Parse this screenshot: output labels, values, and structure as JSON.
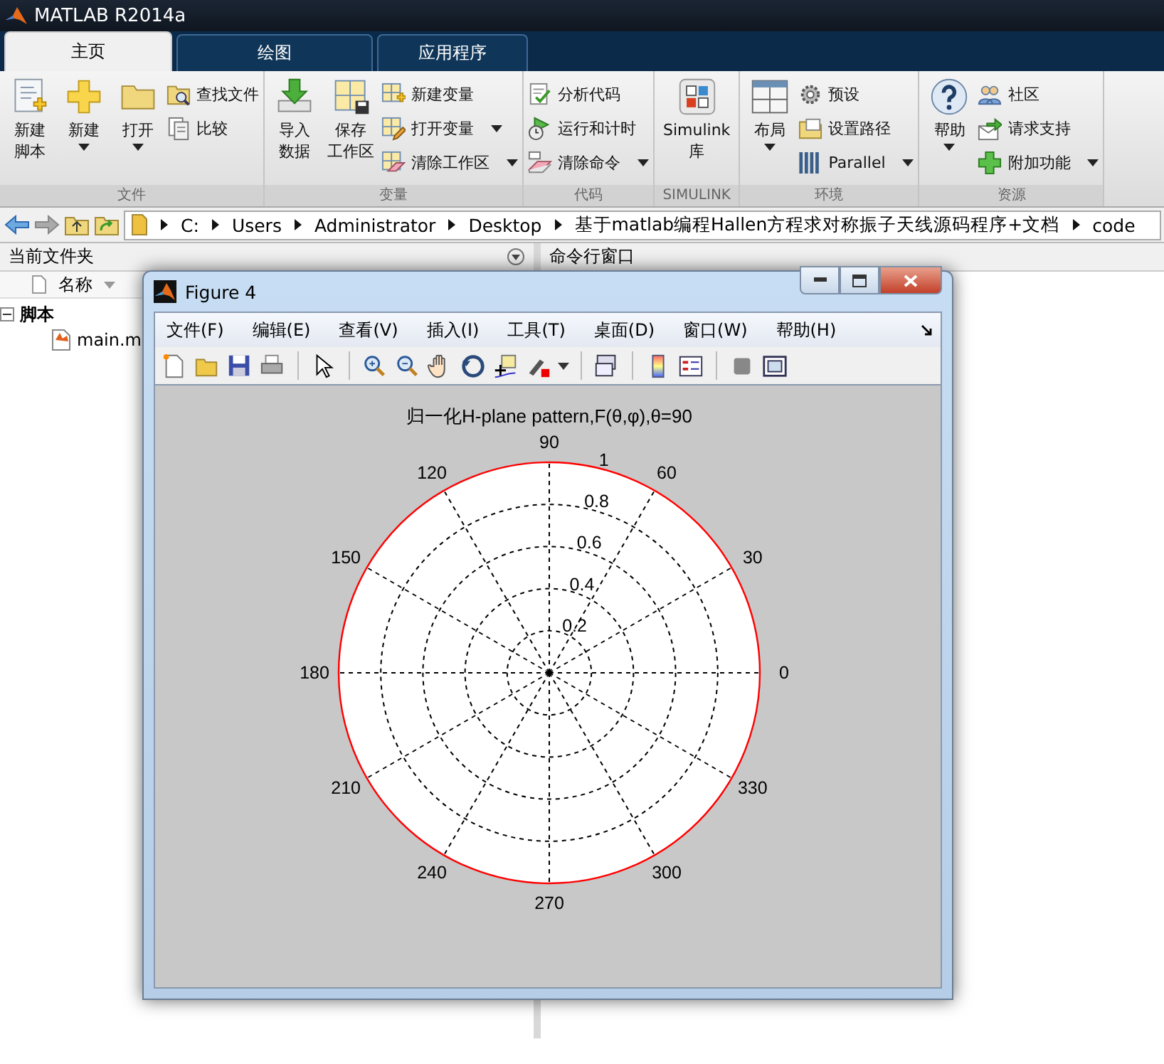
{
  "window": {
    "title": "MATLAB R2014a"
  },
  "tabs": [
    {
      "label": "主页",
      "selected": true
    },
    {
      "label": "绘图",
      "selected": false
    },
    {
      "label": "应用程序",
      "selected": false
    }
  ],
  "ribbon": {
    "sections": [
      {
        "label": "文件",
        "items": [
          {
            "kind": "large",
            "lines": [
              "新建",
              "脚本"
            ],
            "dropdown": false
          },
          {
            "kind": "large",
            "label": "新建",
            "dropdown": true
          },
          {
            "kind": "large",
            "label": "打开",
            "dropdown": true
          },
          {
            "kind": "small",
            "label": "查找文件",
            "dropdown": false
          },
          {
            "kind": "small",
            "label": "比较",
            "dropdown": false
          }
        ]
      },
      {
        "label": "变量",
        "items": [
          {
            "kind": "large",
            "lines": [
              "导入",
              "数据"
            ],
            "dropdown": false
          },
          {
            "kind": "large",
            "lines": [
              "保存",
              "工作区"
            ],
            "dropdown": false
          },
          {
            "kind": "small",
            "label": "新建变量",
            "dropdown": false
          },
          {
            "kind": "small",
            "label": "打开变量",
            "dropdown": true
          },
          {
            "kind": "small",
            "label": "清除工作区",
            "dropdown": true
          }
        ]
      },
      {
        "label": "代码",
        "items": [
          {
            "kind": "small",
            "label": "分析代码",
            "dropdown": false
          },
          {
            "kind": "small",
            "label": "运行和计时",
            "dropdown": false
          },
          {
            "kind": "small",
            "label": "清除命令",
            "dropdown": true
          }
        ]
      },
      {
        "label": "SIMULINK",
        "items": [
          {
            "kind": "large",
            "lines": [
              "Simulink",
              "库"
            ],
            "dropdown": false
          }
        ]
      },
      {
        "label": "环境",
        "items": [
          {
            "kind": "large",
            "label": "布局",
            "dropdown": true
          },
          {
            "kind": "small",
            "label": "预设",
            "dropdown": false
          },
          {
            "kind": "small",
            "label": "设置路径",
            "dropdown": false
          },
          {
            "kind": "small",
            "label": "Parallel",
            "dropdown": true
          }
        ]
      },
      {
        "label": "资源",
        "items": [
          {
            "kind": "large",
            "label": "帮助",
            "dropdown": true
          },
          {
            "kind": "small",
            "label": "社区",
            "dropdown": false
          },
          {
            "kind": "small",
            "label": "请求支持",
            "dropdown": false
          },
          {
            "kind": "small",
            "label": "附加功能",
            "dropdown": true
          }
        ]
      }
    ]
  },
  "address_bar": {
    "path": [
      "C:",
      "Users",
      "Administrator",
      "Desktop",
      "基于matlab编程Hallen方程求对称振子天线源码程序+文档",
      "code"
    ]
  },
  "current_folder": {
    "title": "当前文件夹",
    "column": "名称",
    "tree": [
      {
        "label": "脚本",
        "expanded": true,
        "children": [
          {
            "label": "main.m"
          }
        ]
      }
    ]
  },
  "command_window": {
    "title": "命令行窗口"
  },
  "figure": {
    "title": "Figure 4",
    "menu": [
      "文件(F)",
      "编辑(E)",
      "查看(V)",
      "插入(I)",
      "工具(T)",
      "桌面(D)",
      "窗口(W)",
      "帮助(H)"
    ],
    "plot": {
      "title": "归一化H-plane pattern,F(θ,φ),θ=90",
      "angle_labels": [
        "0",
        "30",
        "60",
        "90",
        "120",
        "150",
        "180",
        "210",
        "240",
        "270",
        "300",
        "330"
      ],
      "radius_labels": [
        "1",
        "0.8",
        "0.6",
        "0.4",
        "0.2"
      ]
    }
  }
}
